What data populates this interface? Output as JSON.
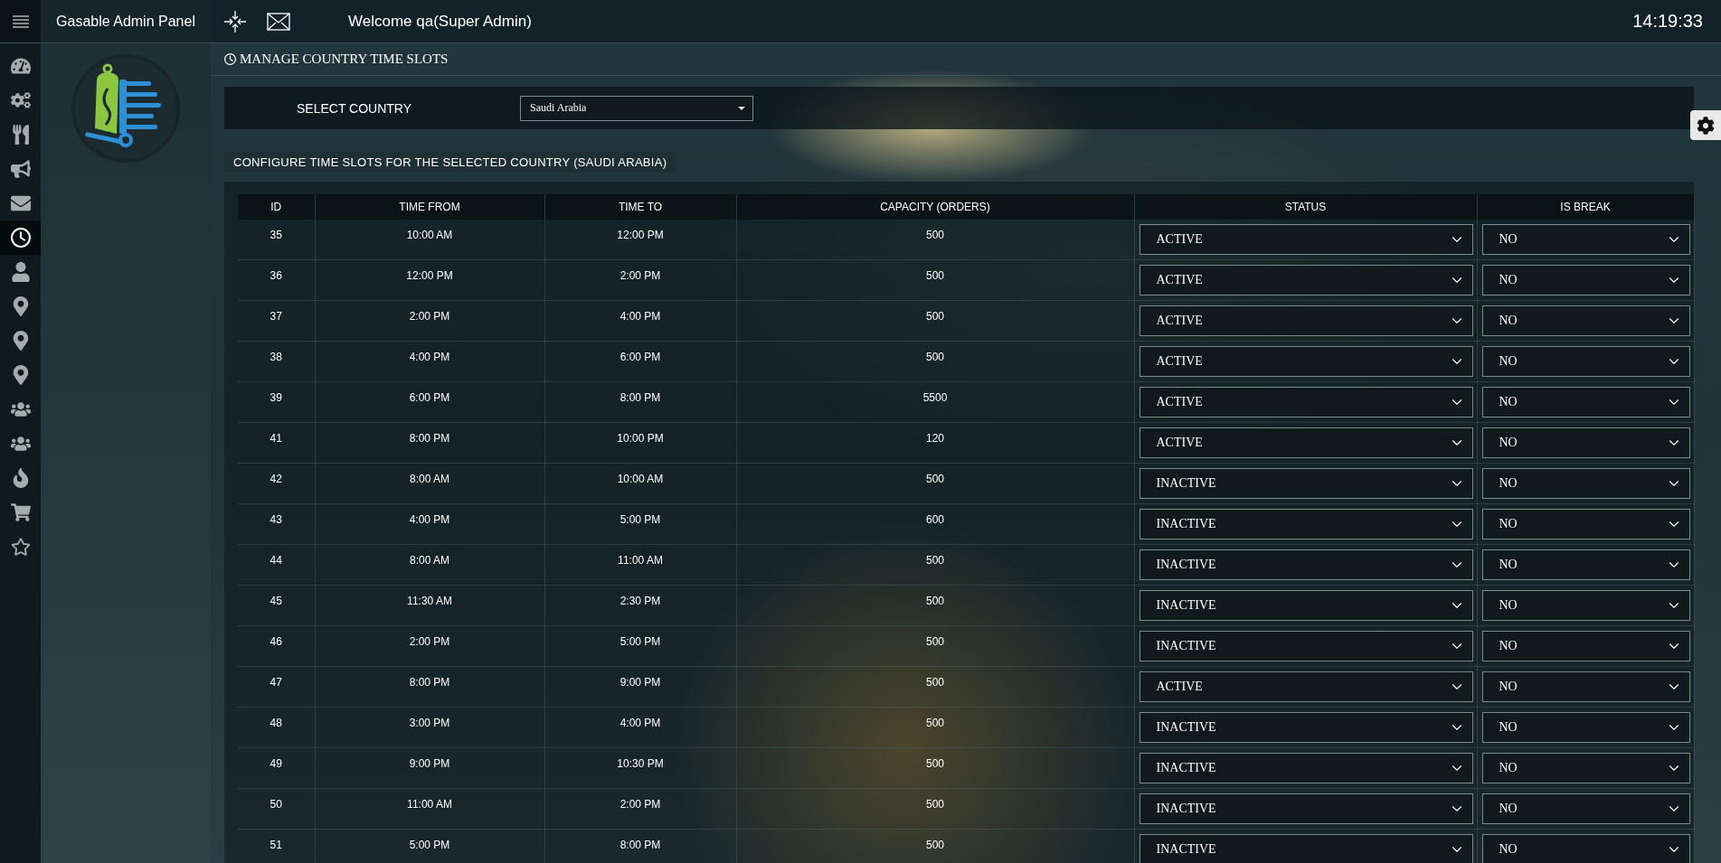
{
  "header": {
    "title": "Gasable Admin Panel",
    "welcome": "Welcome qa(Super Admin)",
    "clock": "14:19:33"
  },
  "sidebar": {
    "items": [
      {
        "selected": false
      },
      {
        "selected": false
      },
      {
        "selected": false
      },
      {
        "selected": false
      },
      {
        "selected": false
      },
      {
        "selected": true
      },
      {
        "selected": false
      },
      {
        "selected": false
      },
      {
        "selected": false
      },
      {
        "selected": false
      },
      {
        "selected": false
      },
      {
        "selected": false
      },
      {
        "selected": false
      },
      {
        "selected": false
      },
      {
        "selected": false
      }
    ]
  },
  "page_title": "MANAGE COUNTRY TIME SLOTS",
  "country_filter": {
    "label": "SELECT COUNTRY",
    "value": "Saudi Arabia"
  },
  "section_title": "CONFIGURE TIME SLOTS FOR THE SELECTED COUNTRY (SAUDI ARABIA)",
  "table": {
    "columns": [
      "ID",
      "TIME FROM",
      "TIME TO",
      "CAPACITY (ORDERS)",
      "STATUS",
      "IS BREAK"
    ],
    "rows": [
      {
        "id": "35",
        "time_from": "10:00 AM",
        "time_to": "12:00 PM",
        "capacity": "500",
        "status": "ACTIVE",
        "is_break": "NO"
      },
      {
        "id": "36",
        "time_from": "12:00 PM",
        "time_to": "2:00 PM",
        "capacity": "500",
        "status": "ACTIVE",
        "is_break": "NO"
      },
      {
        "id": "37",
        "time_from": "2:00 PM",
        "time_to": "4:00 PM",
        "capacity": "500",
        "status": "ACTIVE",
        "is_break": "NO"
      },
      {
        "id": "38",
        "time_from": "4:00 PM",
        "time_to": "6:00 PM",
        "capacity": "500",
        "status": "ACTIVE",
        "is_break": "NO"
      },
      {
        "id": "39",
        "time_from": "6:00 PM",
        "time_to": "8:00 PM",
        "capacity": "5500",
        "status": "ACTIVE",
        "is_break": "NO"
      },
      {
        "id": "41",
        "time_from": "8:00 PM",
        "time_to": "10:00 PM",
        "capacity": "120",
        "status": "ACTIVE",
        "is_break": "NO"
      },
      {
        "id": "42",
        "time_from": "8:00 AM",
        "time_to": "10:00 AM",
        "capacity": "500",
        "status": "INACTIVE",
        "is_break": "NO"
      },
      {
        "id": "43",
        "time_from": "4:00 PM",
        "time_to": "5:00 PM",
        "capacity": "600",
        "status": "INACTIVE",
        "is_break": "NO"
      },
      {
        "id": "44",
        "time_from": "8:00 AM",
        "time_to": "11:00 AM",
        "capacity": "500",
        "status": "INACTIVE",
        "is_break": "NO"
      },
      {
        "id": "45",
        "time_from": "11:30 AM",
        "time_to": "2:30 PM",
        "capacity": "500",
        "status": "INACTIVE",
        "is_break": "NO"
      },
      {
        "id": "46",
        "time_from": "2:00 PM",
        "time_to": "5:00 PM",
        "capacity": "500",
        "status": "INACTIVE",
        "is_break": "NO"
      },
      {
        "id": "47",
        "time_from": "8:00 PM",
        "time_to": "9:00 PM",
        "capacity": "500",
        "status": "ACTIVE",
        "is_break": "NO"
      },
      {
        "id": "48",
        "time_from": "3:00 PM",
        "time_to": "4:00 PM",
        "capacity": "500",
        "status": "INACTIVE",
        "is_break": "NO"
      },
      {
        "id": "49",
        "time_from": "9:00 PM",
        "time_to": "10:30 PM",
        "capacity": "500",
        "status": "INACTIVE",
        "is_break": "NO"
      },
      {
        "id": "50",
        "time_from": "11:00 AM",
        "time_to": "2:00 PM",
        "capacity": "500",
        "status": "INACTIVE",
        "is_break": "NO"
      },
      {
        "id": "51",
        "time_from": "5:00 PM",
        "time_to": "8:00 PM",
        "capacity": "500",
        "status": "INACTIVE",
        "is_break": "NO"
      }
    ]
  }
}
